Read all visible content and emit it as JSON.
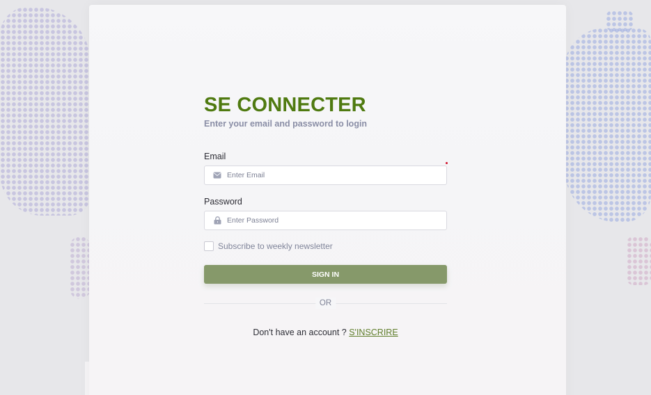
{
  "login": {
    "title": "SE CONNECTER",
    "subtitle": "Enter your email and password to login",
    "email_label": "Email",
    "email_placeholder": "Enter Email",
    "email_icon": "envelope-icon",
    "password_label": "Password",
    "password_placeholder": "Enter Password",
    "password_icon": "lock-icon",
    "newsletter_label": "Subscribe to weekly newsletter",
    "newsletter_checked": false,
    "signin_label": "SIGN IN",
    "divider_label": "OR",
    "signup_prompt": "Don't have an account ? ",
    "signup_link": "S'INSCRIRE"
  },
  "colors": {
    "title": "#4f7a10",
    "button": "#86996a",
    "link": "#5f7d2a",
    "required_dot": "#d0112b"
  }
}
